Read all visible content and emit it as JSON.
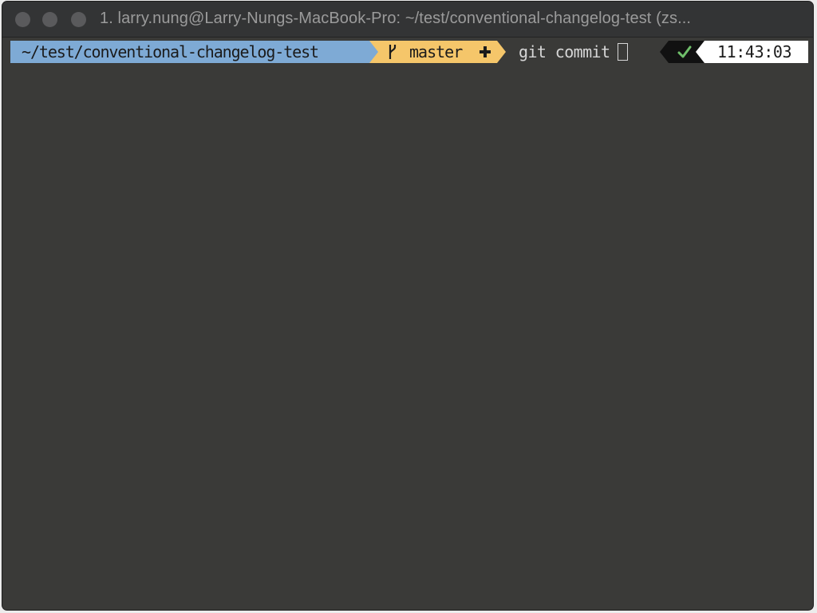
{
  "window": {
    "title": "1. larry.nung@Larry-Nungs-MacBook-Pro: ~/test/conventional-changelog-test (zs..."
  },
  "prompt": {
    "directory": "~/test/conventional-changelog-test",
    "branch": "master",
    "branch_icon": "git-branch-icon",
    "dirty_icon": "plus-icon",
    "command": "git commit",
    "status_icon": "check-icon",
    "time": "11:43:03"
  },
  "colors": {
    "terminal_bg": "#3a3a38",
    "titlebar_bg": "#333435",
    "dir_segment": "#7eaad5",
    "git_segment": "#f5c66a",
    "status_segment": "#111111",
    "status_check": "#6fbf6a",
    "time_segment": "#ffffff"
  }
}
